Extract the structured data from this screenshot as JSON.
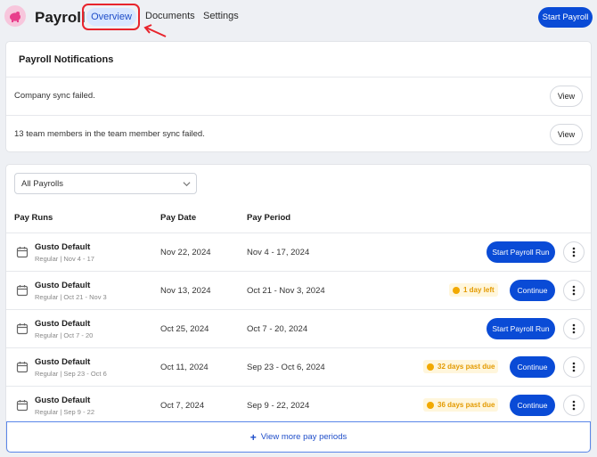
{
  "header": {
    "title": "Payroll",
    "tabs": [
      {
        "label": "Overview",
        "active": true
      },
      {
        "label": "Documents",
        "active": false
      },
      {
        "label": "Settings",
        "active": false
      }
    ],
    "start_payroll_label": "Start Payroll",
    "accent_color": "#0a4bd6"
  },
  "notifications": {
    "title": "Payroll Notifications",
    "items": [
      {
        "text": "Company sync failed.",
        "action": "View"
      },
      {
        "text": "13 team members in the team member sync failed.",
        "action": "View"
      }
    ]
  },
  "pay_runs": {
    "filter": {
      "value": "All Payrolls"
    },
    "columns": [
      "Pay Runs",
      "Pay Date",
      "Pay Period"
    ],
    "rows": [
      {
        "name": "Gusto Default",
        "sub": "Regular | Nov 4 - 17",
        "pay_date": "Nov 22, 2024",
        "period": "Nov 4 - 17, 2024",
        "badge": "",
        "action": "Start Payroll Run"
      },
      {
        "name": "Gusto Default",
        "sub": "Regular | Oct 21 - Nov 3",
        "pay_date": "Nov 13, 2024",
        "period": "Oct 21 - Nov 3, 2024",
        "badge": "1 day left",
        "action": "Continue"
      },
      {
        "name": "Gusto Default",
        "sub": "Regular | Oct 7 - 20",
        "pay_date": "Oct 25, 2024",
        "period": "Oct 7 - 20, 2024",
        "badge": "",
        "action": "Start Payroll Run"
      },
      {
        "name": "Gusto Default",
        "sub": "Regular | Sep 23 - Oct 6",
        "pay_date": "Oct 11, 2024",
        "period": "Sep 23 - Oct 6, 2024",
        "badge": "32 days past due",
        "action": "Continue"
      },
      {
        "name": "Gusto Default",
        "sub": "Regular | Sep 9 - 22",
        "pay_date": "Oct 7, 2024",
        "period": "Sep 9 - 22, 2024",
        "badge": "36 days past due",
        "action": "Continue"
      }
    ],
    "view_more_label": "View more pay periods",
    "badge_color": "#e39a00"
  }
}
